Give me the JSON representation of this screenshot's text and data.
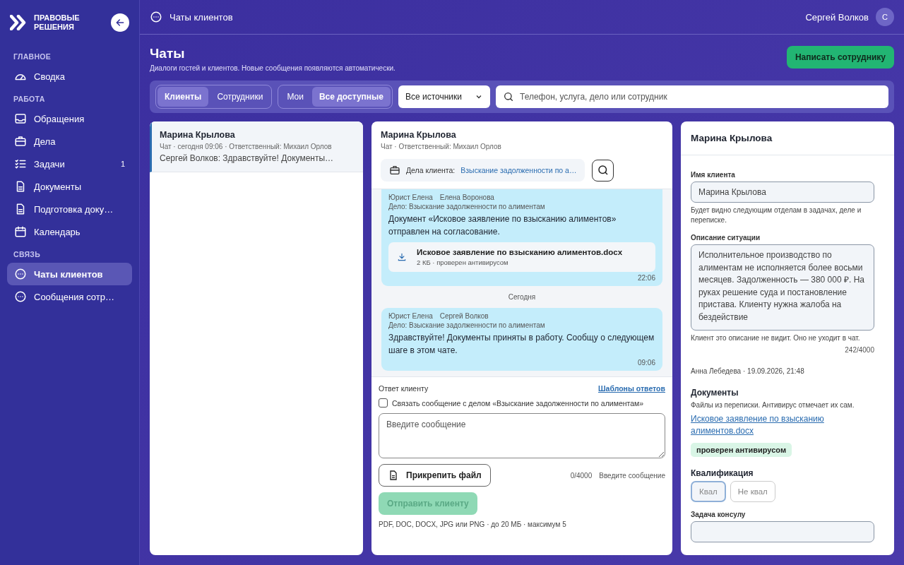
{
  "sidebar": {
    "brand": "ПРАВОВЫЕ РЕШЕНИЯ",
    "sections": [
      {
        "title": "ГЛАВНОЕ",
        "items": [
          {
            "label": "Сводка",
            "selected": false
          }
        ]
      },
      {
        "title": "РАБОТА",
        "items": [
          {
            "label": "Обращения",
            "selected": false
          },
          {
            "label": "Дела",
            "selected": false
          },
          {
            "label": "Задачи",
            "badge": "1",
            "selected": false
          },
          {
            "label": "Документы",
            "selected": false
          },
          {
            "label": "Подготовка доку…",
            "selected": false
          },
          {
            "label": "Календарь",
            "selected": false
          }
        ]
      },
      {
        "title": "СВЯЗЬ",
        "items": [
          {
            "label": "Чаты клиентов",
            "selected": true
          },
          {
            "label": "Сообщения сотр…",
            "selected": false
          }
        ]
      }
    ]
  },
  "header": {
    "breadcrumb": "Чаты клиентов",
    "user": "Сергей Волков",
    "avatar": "С"
  },
  "page": {
    "title": "Чаты",
    "subtitle": "Диалоги гостей и клиентов. Новые сообщения появляются автоматически.",
    "action": "Написать сотруднику"
  },
  "filters": {
    "groups": [
      [
        {
          "label": "Клиенты",
          "selected": true
        },
        {
          "label": "Сотрудники",
          "selected": false
        }
      ],
      [
        {
          "label": "Мои",
          "selected": false
        },
        {
          "label": "Все доступные",
          "selected": true
        }
      ]
    ],
    "source": "Все источники",
    "search_placeholder": "Телефон, услуга, дело или сотрудник"
  },
  "chat_list": [
    {
      "name": "Марина Крылова",
      "meta": "Чат · сегодня 09:06 · Ответственный: Михаил Орлов",
      "preview": "Сергей Волков: Здравствуйте! Документы…",
      "selected": true
    }
  ],
  "chat": {
    "name": "Марина Крылова",
    "meta": "Чат · Ответственный: Михаил Орлов",
    "case_label": "Дела клиента:",
    "case_link": "Взыскание задолженности по а…",
    "messages": [
      {
        "kind": "message",
        "role": "Юрист Елена",
        "sender": "Елена Воронова",
        "case": "Дело: Взыскание задолженности по алиментам",
        "text": "Документ «Исковое заявление по взысканию алиментов» отправлен на согласование.",
        "attachment": {
          "name": "Исковое заявление по взысканию алиментов.docx",
          "meta": "2 КБ · проверен антивирусом"
        },
        "time": "22:06"
      },
      {
        "kind": "date",
        "text": "Сегодня"
      },
      {
        "kind": "message",
        "role": "Юрист Елена",
        "sender": "Сергей Волков",
        "case": "Дело: Взыскание задолженности по алиментам",
        "text": "Здравствуйте! Документы приняты в работу. Сообщу о следующем шаге в этом чате.",
        "time": "09:06"
      }
    ],
    "reply": {
      "label": "Ответ клиенту",
      "templates": "Шаблоны ответов",
      "link_case": {
        "label": "Связать сообщение с делом «Взыскание задолженности по алиментам»",
        "checked": false
      },
      "placeholder": "Введите сообщение",
      "attach": "Прикрепить файл",
      "counter": "0/4000",
      "hint": "Введите сообщение",
      "send": {
        "label": "Отправить клиенту",
        "disabled": true
      },
      "formats": "PDF, DOC, DOCX, JPG или PNG · до 20 МБ · максимум 5"
    }
  },
  "client": {
    "title": "Марина Крылова",
    "name_label": "Имя клиента",
    "name_value": "Марина Крылова",
    "name_hint": "Будет видно следующим отделам в задачах, деле и переписке.",
    "desc_label": "Описание ситуации",
    "desc_value": "Исполнительное производство по алиментам не исполняется более восьми месяцев. Задолженность — 380 000 ₽. На руках решение суда и постановление пристава. Клиенту нужна жалоба на бездействие",
    "desc_hint": "Клиент это описание не видит. Оно не уходит в чат.",
    "desc_counter": "242/4000",
    "author": "Анна Лебедева · 19.09.2026, 21:48",
    "docs_title": "Документы",
    "docs_hint": "Файлы из переписки. Антивирус отмечает их сам.",
    "doc_link": "Исковое заявление по взысканию алиментов.docx",
    "doc_badge": "проверен антивирусом",
    "qual_title": "Квалификация",
    "qual_options": [
      {
        "label": "Квал",
        "selected": true
      },
      {
        "label": "Не квал",
        "selected": false
      }
    ],
    "task_label": "Задача консулу"
  }
}
